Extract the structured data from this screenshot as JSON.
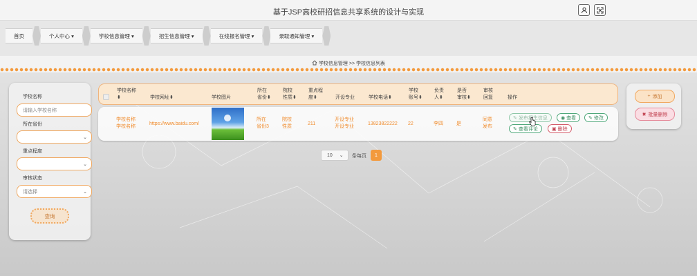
{
  "header": {
    "title": "基于JSP高校研招信息共享系统的设计与实现"
  },
  "icons": {
    "user": "user-icon",
    "fullscreen": "fullscreen-icon",
    "home": "home-icon",
    "cursor": "hand-cursor-icon"
  },
  "nav": {
    "items": [
      {
        "label": "首页"
      },
      {
        "label": "个人中心 ▾"
      },
      {
        "label": "学校信息管理 ▾"
      },
      {
        "label": "招生信息管理 ▾"
      },
      {
        "label": "在线报名管理 ▾"
      },
      {
        "label": "录取通知管理 ▾"
      }
    ]
  },
  "breadcrumb": {
    "text": "学校信息管理 >> 学校信息列表"
  },
  "search": {
    "school_name_label": "学校名称",
    "school_name_placeholder": "请输入学校名称",
    "province_label": "所在省份",
    "key_level_label": "重点程度",
    "review_status_label": "审核状态",
    "review_status_placeholder": "请选择",
    "query_button": "查询"
  },
  "table": {
    "headers": {
      "school_name": "学校名称",
      "school_name_sort": "⬍",
      "school_url": "学校网址⬍",
      "school_image": "学校图片",
      "province_1": "所在",
      "province_2": "省份⬍",
      "nature_1": "院校",
      "nature_2": "性质⬍",
      "key_1": "重点程",
      "key_2": "度⬍",
      "majors": "开设专业",
      "phone": "学校电话⬍",
      "account_1": "学校",
      "account_2": "账号⬍",
      "owner_1": "负责",
      "owner_2": "人⬍",
      "reviewed_1": "是否",
      "reviewed_2": "审核⬍",
      "reply_1": "审核",
      "reply_2": "回复",
      "actions": "操作"
    },
    "rows": [
      {
        "school_name_1": "学校名称",
        "school_name_2": "学校名称",
        "url": "https://www.baidu.com/",
        "province_1": "所在",
        "province_2": "省份3",
        "nature_1": "院校",
        "nature_2": "性质",
        "key_level": "211",
        "major_1": "开设专业",
        "major_2": "开设专业",
        "phone": "13823822222",
        "account": "22",
        "owner": "李四",
        "reviewed": "是",
        "reply_1": "同意",
        "reply_2": "发布",
        "actions": {
          "publish": "发布招生信息",
          "view": "查看",
          "edit": "修改",
          "view_comments": "查看评论",
          "delete": "删除"
        }
      }
    ]
  },
  "pagination": {
    "page_size": "10",
    "page_size_label": "条每页",
    "current_page": "1"
  },
  "side_actions": {
    "add": "添加",
    "batch_delete": "批量删除"
  },
  "colors": {
    "accent": "#f39a3d",
    "danger": "#c0404f",
    "success": "#3e8e63"
  }
}
